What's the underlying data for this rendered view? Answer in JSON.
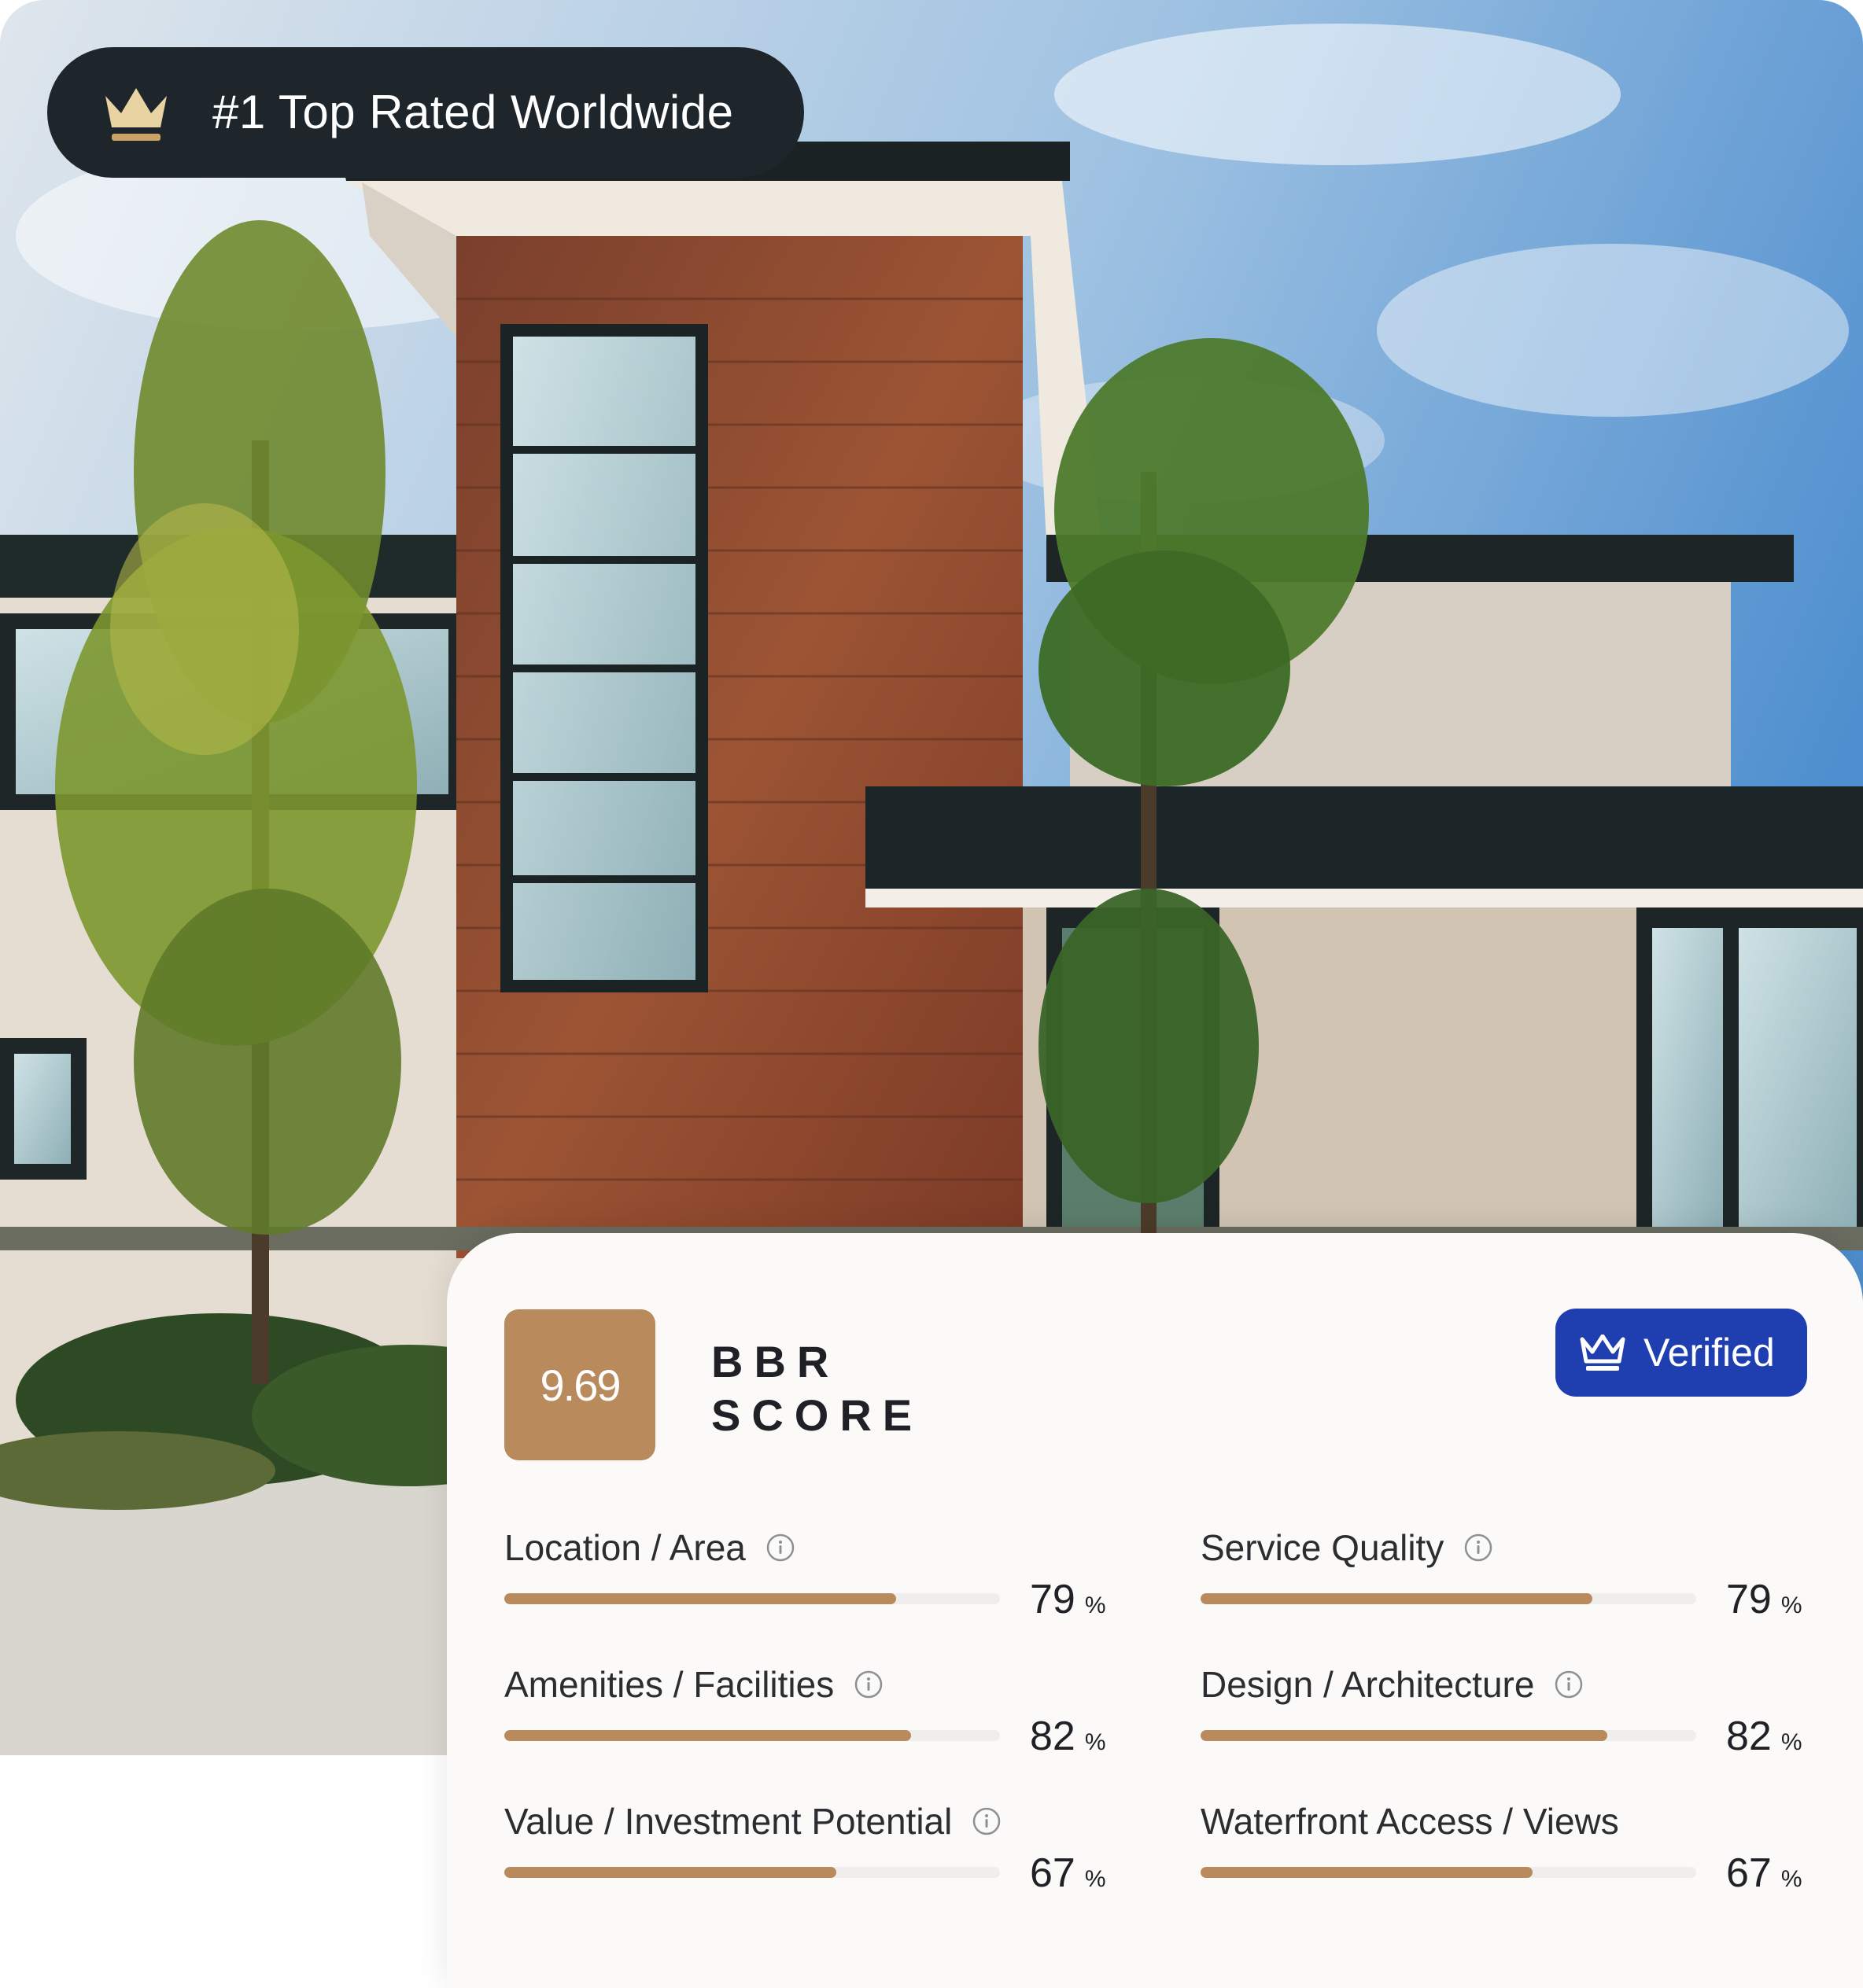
{
  "badge": {
    "text": "#1 Top Rated Worldwide",
    "icon": "crown-icon"
  },
  "score": {
    "value": "9.69",
    "label_line1": "BBR",
    "label_line2": "SCORE"
  },
  "verified": {
    "label": "Verified",
    "icon": "crown-icon"
  },
  "metrics": [
    {
      "label": "Location / Area",
      "value": "79",
      "unit": "%",
      "fraction": 0.79,
      "info": true
    },
    {
      "label": "Service Quality",
      "value": "79",
      "unit": "%",
      "fraction": 0.79,
      "info": true
    },
    {
      "label": "Amenities / Facilities",
      "value": "82",
      "unit": "%",
      "fraction": 0.82,
      "info": true
    },
    {
      "label": "Design / Architecture",
      "value": "82",
      "unit": "%",
      "fraction": 0.82,
      "info": true
    },
    {
      "label": "Value / Investment Potential",
      "value": "67",
      "unit": "%",
      "fraction": 0.67,
      "info": true
    },
    {
      "label": "Waterfront Access / Views",
      "value": "67",
      "unit": "%",
      "fraction": 0.67,
      "info": false
    }
  ],
  "colors": {
    "accent": "#b98a5b",
    "verified": "#1f3fb0",
    "badge_bg": "#1f262b",
    "card_bg": "#fbfaf8"
  }
}
